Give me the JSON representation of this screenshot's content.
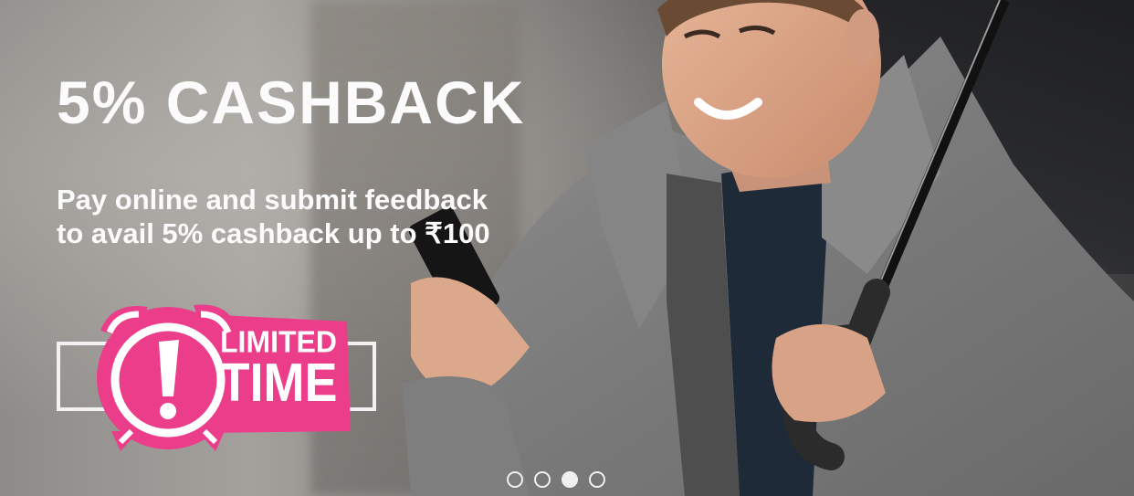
{
  "banner": {
    "headline": "5% CASHBACK",
    "subtext_line1": "Pay online and submit feedback",
    "subtext_line2": "to avail 5% cashback up to ₹100",
    "badge": {
      "line1": "LIMITED",
      "line2": "TIME",
      "icon": "alarm-clock-exclamation-icon",
      "color": "#ec3d8a"
    },
    "hero_image": "man-with-phone-and-umbrella",
    "carousel": {
      "slide_count": 4,
      "active_index": 2
    }
  }
}
